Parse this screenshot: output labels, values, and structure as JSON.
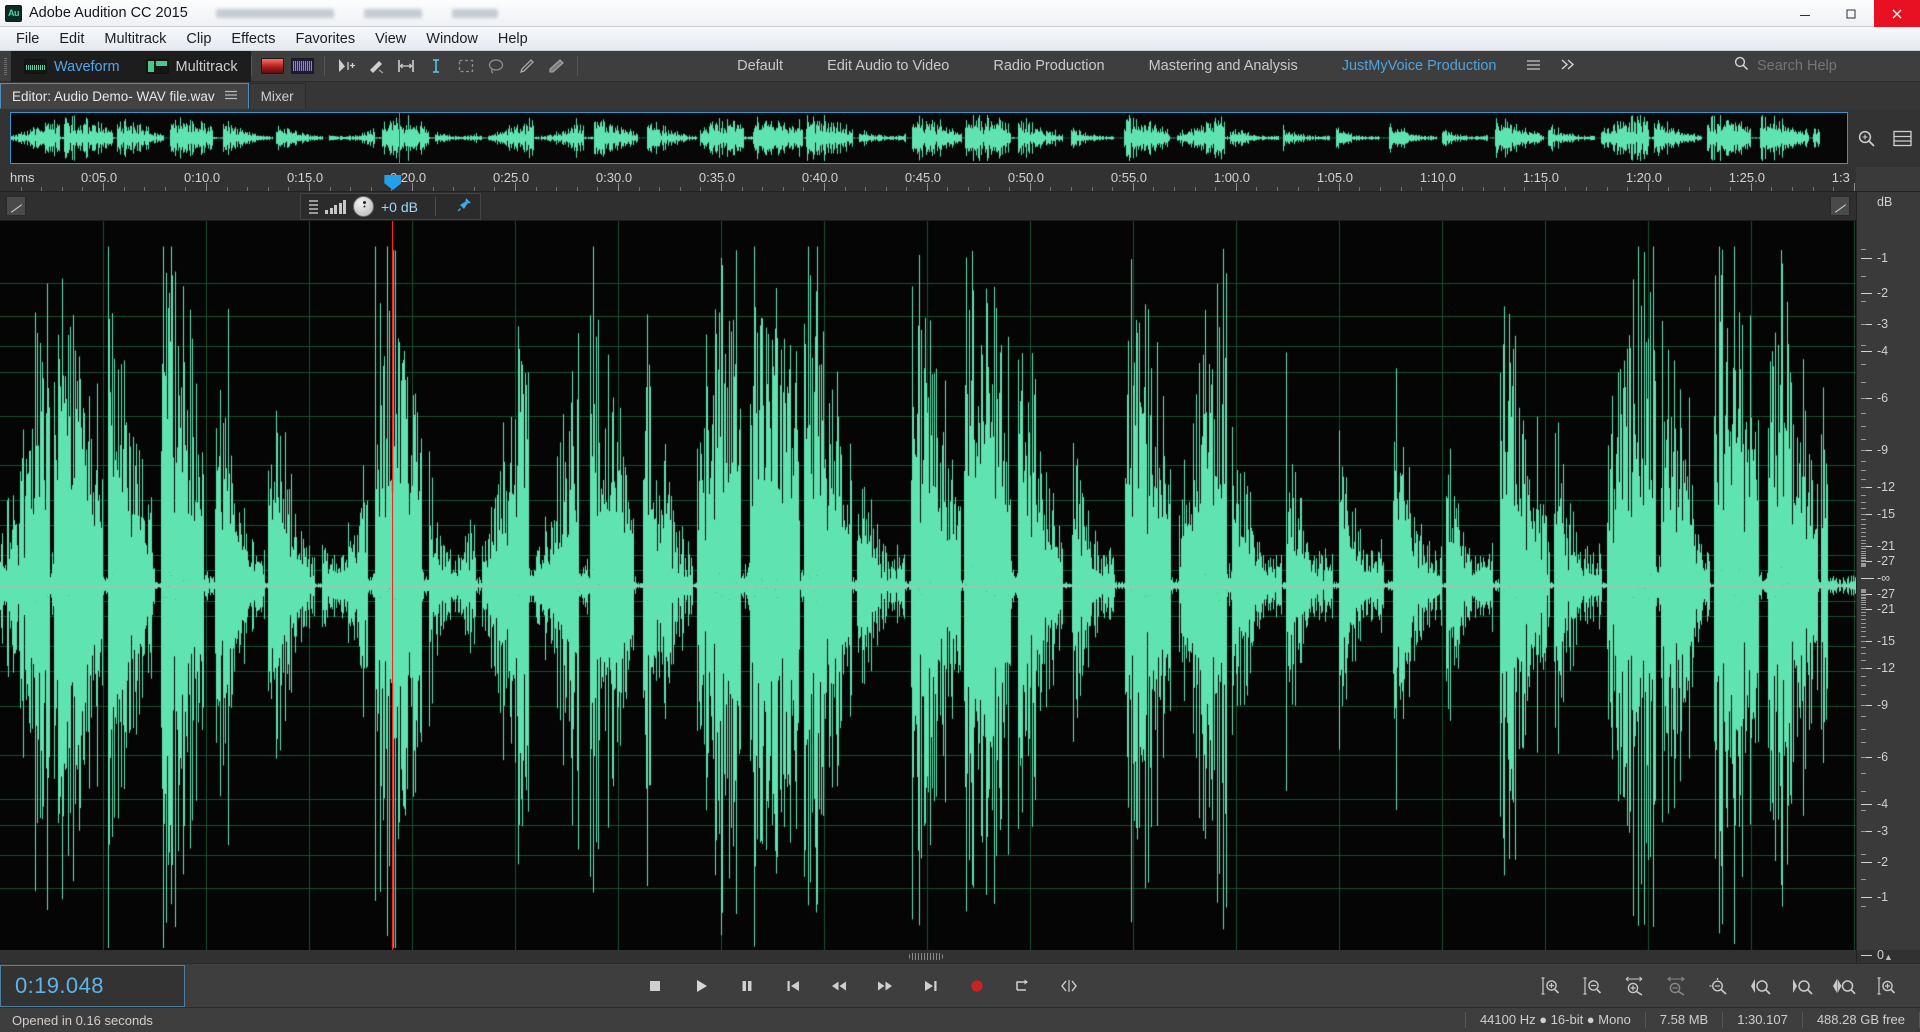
{
  "window": {
    "app_title": "Adobe Audition CC 2015",
    "logo_text": "Au",
    "minimize_label": "Minimize",
    "maximize_label": "Maximize",
    "close_label": "Close"
  },
  "menubar": {
    "items": [
      {
        "label": "File"
      },
      {
        "label": "Edit"
      },
      {
        "label": "Multitrack"
      },
      {
        "label": "Clip"
      },
      {
        "label": "Effects"
      },
      {
        "label": "Favorites"
      },
      {
        "label": "View"
      },
      {
        "label": "Window"
      },
      {
        "label": "Help"
      }
    ]
  },
  "toolbar": {
    "modes": [
      {
        "label": "Waveform",
        "active": true,
        "icon": "waveform-icon"
      },
      {
        "label": "Multitrack",
        "active": false,
        "icon": "multitrack-icon"
      }
    ],
    "view_buttons": [
      {
        "name": "spectral-frequency-display-button",
        "icon": "red-spectrum-icon"
      },
      {
        "name": "spectral-pan-display-button",
        "icon": "purple-spectrum-icon"
      }
    ],
    "tools": [
      {
        "name": "move-tool",
        "icon": "move-arrow-icon"
      },
      {
        "name": "slip-tool",
        "icon": "slip-icon"
      },
      {
        "name": "razor-selected-clip-tool",
        "icon": "time-selection-icon"
      },
      {
        "name": "time-selection-tool",
        "icon": "i-beam-icon"
      },
      {
        "name": "marquee-selection-tool",
        "icon": "marquee-icon"
      },
      {
        "name": "lasso-selection-tool",
        "icon": "lasso-icon"
      },
      {
        "name": "paintbrush-selection-tool",
        "icon": "brush-icon"
      },
      {
        "name": "spot-healing-brush-tool",
        "icon": "healing-brush-icon"
      }
    ],
    "workspaces": [
      {
        "label": "Default",
        "active": false
      },
      {
        "label": "Edit Audio to Video",
        "active": false
      },
      {
        "label": "Radio Production",
        "active": false
      },
      {
        "label": "Mastering and Analysis",
        "active": false
      },
      {
        "label": "JustMyVoice Production",
        "active": true
      }
    ],
    "workspace_menu_icon": "hamburger-icon",
    "workspace_overflow_icon": "chevron-double-right-icon",
    "search": {
      "icon": "search-icon",
      "placeholder": "Search Help",
      "value": ""
    }
  },
  "panel_tabs": [
    {
      "label": "Editor: Audio Demo- WAV file.wav",
      "active": true,
      "menu_icon": "panel-menu-icon"
    },
    {
      "label": "Mixer",
      "active": false
    }
  ],
  "overview": {
    "zoom_icon": "zoom-magnifier-icon",
    "layout_icon": "panel-layout-icon",
    "playhead_position_pct": 21.1
  },
  "timeline": {
    "unit_label": "hms",
    "ticks": [
      "0:05.0",
      "0:10.0",
      "0:15.0",
      "0:20.0",
      "0:25.0",
      "0:30.0",
      "0:35.0",
      "0:40.0",
      "0:45.0",
      "0:50.0",
      "0:55.0",
      "1:00.0",
      "1:05.0",
      "1:10.0",
      "1:15.0",
      "1:20.0",
      "1:25.0",
      "1:3"
    ],
    "start_seconds": 0,
    "end_seconds": 90.107,
    "playhead_seconds": 19.048
  },
  "clip_header": {
    "gain_value": "+0 dB",
    "level_icon": "level-bars-icon",
    "list_icon": "list-lines-icon",
    "knob_icon": "gain-knob-icon",
    "pin_icon": "pin-icon",
    "left_handle_icon": "clip-fade-handle-icon",
    "right_handle_icon": "clip-fade-handle-icon"
  },
  "amplitude_ruler": {
    "title": "dB",
    "labels": [
      "-1",
      "-2",
      "-3",
      "-4",
      "-6",
      "-9",
      "-12",
      "-15",
      "-21",
      "-27",
      "-∞",
      "-27",
      "-21",
      "-15",
      "-12",
      "-9",
      "-6",
      "-4",
      "-3",
      "-2",
      "-1",
      "0"
    ]
  },
  "transport": {
    "timecode": "0:19.048",
    "buttons": [
      {
        "name": "stop-button",
        "icon": "stop-icon"
      },
      {
        "name": "play-button",
        "icon": "play-icon"
      },
      {
        "name": "pause-button",
        "icon": "pause-icon"
      },
      {
        "name": "move-playhead-to-previous-button",
        "icon": "skip-to-start-icon"
      },
      {
        "name": "rewind-button",
        "icon": "rewind-icon"
      },
      {
        "name": "fast-forward-button",
        "icon": "fast-forward-icon"
      },
      {
        "name": "move-playhead-to-next-button",
        "icon": "skip-to-end-icon"
      },
      {
        "name": "record-button",
        "icon": "record-icon"
      },
      {
        "name": "loop-playback-button",
        "icon": "loop-icon"
      },
      {
        "name": "skip-selection-button",
        "icon": "skip-selection-icon"
      }
    ],
    "zoom_buttons": [
      {
        "name": "zoom-in-amplitude-button",
        "icon": "zoom-in-vertical-icon"
      },
      {
        "name": "zoom-out-amplitude-button",
        "icon": "zoom-out-vertical-icon"
      },
      {
        "name": "zoom-in-time-button",
        "icon": "zoom-in-horizontal-icon"
      },
      {
        "name": "zoom-out-time-button",
        "icon": "zoom-out-horizontal-icon"
      },
      {
        "name": "zoom-out-full-button",
        "icon": "zoom-full-icon"
      },
      {
        "name": "zoom-to-selection-in-point-button",
        "icon": "zoom-in-point-icon"
      },
      {
        "name": "zoom-to-selection-out-point-button",
        "icon": "zoom-out-point-icon"
      },
      {
        "name": "zoom-to-selection-button",
        "icon": "zoom-selection-icon"
      },
      {
        "name": "zoom-in-amplitude-alt-button",
        "icon": "zoom-amplitude-icon"
      }
    ]
  },
  "status_bar": {
    "message": "Opened in 0.16 seconds",
    "cells": [
      "44100 Hz ● 16-bit ● Mono",
      "7.58 MB",
      "1:30.107",
      "488.28 GB free"
    ]
  },
  "colors": {
    "waveform": "#5fe3b0",
    "accent_blue": "#4ea3de",
    "playhead_red": "#ff2020",
    "grid_green": "#14512f",
    "panel_bg": "#3e3e3e",
    "wave_bg": "#050505"
  },
  "chart_data": {
    "type": "area",
    "title": "Audio Demo- WAV file.wav waveform",
    "xlabel": "hms",
    "ylabel": "dB",
    "xlim": [
      0,
      90.107
    ],
    "ylim": [
      -1,
      1
    ],
    "grid": true
  }
}
